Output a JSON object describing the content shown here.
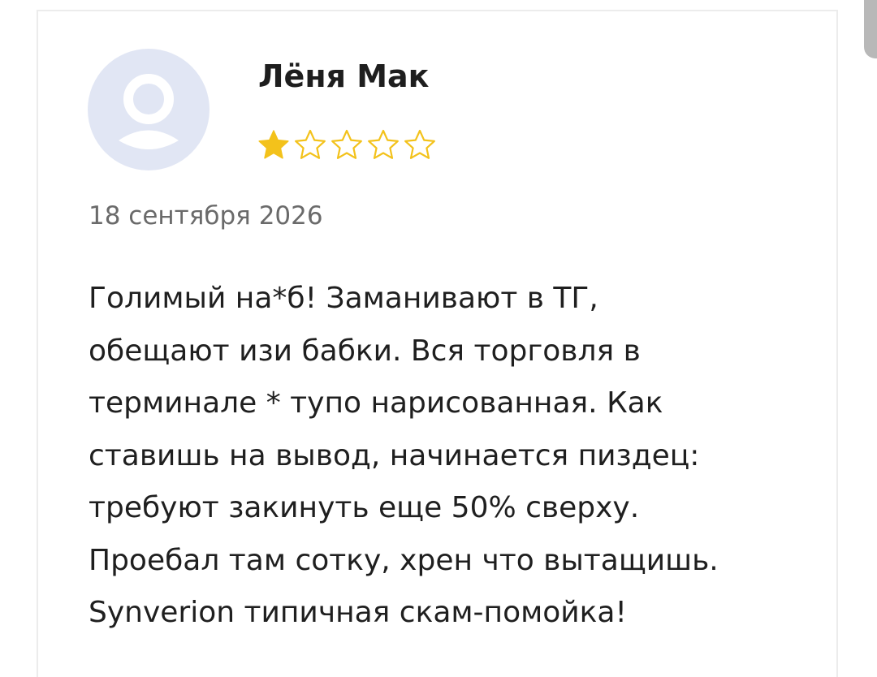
{
  "review": {
    "author": "Лёня Мак",
    "rating": 1,
    "max_rating": 5,
    "date": "18 сентября 2026",
    "lines": [
      "Голимый на*б! Заманивают в ТГ,",
      "обещают изи бабки. Вся торговля в",
      "терминале * тупо нарисованная. Как",
      "ставишь на вывод, начинается пиздец:",
      "требуют закинуть еще 50% сверху.",
      "Проебал там сотку, хрен что вытащишь.",
      "Synverion типичная скам-помойка!"
    ]
  },
  "icons": {
    "avatar": "user-placeholder-icon",
    "star_filled": "star-filled-icon",
    "star_empty": "star-outline-icon"
  },
  "colors": {
    "star": "#f3c21b",
    "avatar_bg": "#e1e6f4",
    "text": "#1f1f1f",
    "date": "#6a6a6a",
    "card_border": "#ececec"
  }
}
